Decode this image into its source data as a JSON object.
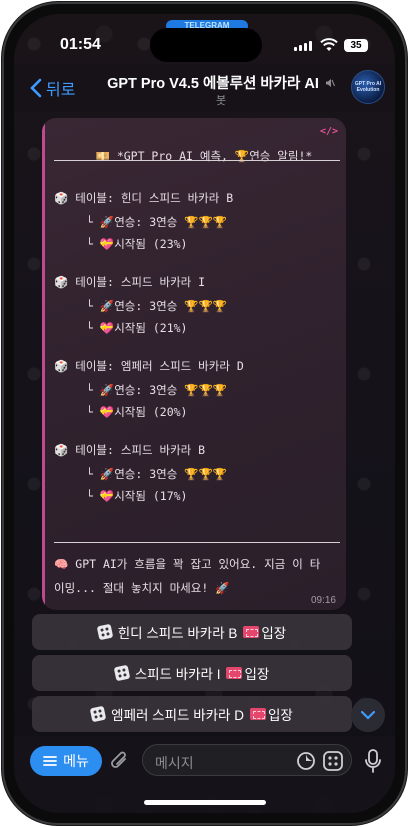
{
  "status": {
    "time": "01:54",
    "battery": "35",
    "top_pill": "TELEGRAM"
  },
  "header": {
    "back_label": "뒤로",
    "title": "GPT Pro V4.5 에볼루션 바카라 AI",
    "subtitle": "봇",
    "avatar_text": "GPT Pro AI Evolution"
  },
  "message": {
    "headline": "*GPT Pro AI 예측, 🏆연승 알림!*",
    "tables": [
      {
        "table": "테이블: 힌디 스피드 바카라 B",
        "streak": "연승: 3연승",
        "trophies": "🏆🏆🏆",
        "started": "시작됨 (23%)"
      },
      {
        "table": "테이블: 스피드 바카라 I",
        "streak": "연승: 3연승",
        "trophies": "🏆🏆🏆",
        "started": "시작됨 (21%)"
      },
      {
        "table": "테이블: 엠페러 스피드 바카라 D",
        "streak": "연승: 3연승",
        "trophies": "🏆🏆🏆",
        "started": "시작됨 (20%)"
      },
      {
        "table": "테이블: 스피드 바카라 B",
        "streak": "연승: 3연승",
        "trophies": "🏆🏆🏆",
        "started": "시작됨 (17%)"
      }
    ],
    "footer_line1": "GPT AI가 흐름을 꽉 잡고 있어요. 지금 이 타",
    "footer_line2": "이밍... 절대 놓치지 마세요! 🚀",
    "time": "09:16"
  },
  "buttons": [
    {
      "label": "힌디 스피드 바카라 B",
      "suffix": "입장"
    },
    {
      "label": "스피드 바카라 I",
      "suffix": "입장"
    },
    {
      "label": "엠페러 스피드 바카라 D",
      "suffix": "입장"
    }
  ],
  "inputbar": {
    "menu_label": "메뉴",
    "placeholder": "메시지"
  },
  "colors": {
    "accent": "#2d8ef2",
    "bubble": "#30222e",
    "quote_bar": "#c04a8f"
  },
  "icons": [
    "back-chevron-icon",
    "mute-icon",
    "dice-icon",
    "rocket-icon",
    "sparkle-icon",
    "trophy-icon",
    "ticket-icon",
    "brain-icon",
    "paperclip-icon",
    "sticker-icon",
    "keyboard-icon",
    "mic-icon",
    "chevron-down-icon"
  ]
}
